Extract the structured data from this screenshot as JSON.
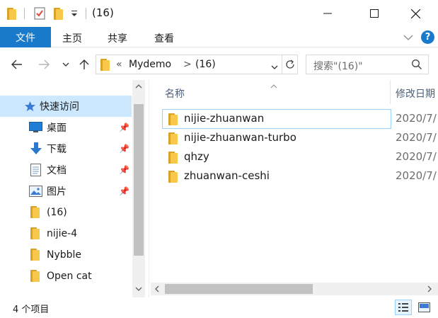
{
  "window": {
    "title": "(16)",
    "controls": {
      "minimize": "—",
      "maximize": "☐",
      "close": "✕"
    }
  },
  "ribbon": {
    "file_tab": "文件",
    "tabs": [
      "主页",
      "共享",
      "查看"
    ],
    "help": "?",
    "accent": "#1979ca"
  },
  "address": {
    "prefix": "«",
    "segments": [
      "Mydemo",
      "(16)"
    ],
    "separator": ">"
  },
  "search": {
    "placeholder": "搜索\"(16)\""
  },
  "nav_pane": {
    "items": [
      {
        "label": "快速访问",
        "icon": "star-icon",
        "pinned": false
      },
      {
        "label": "桌面",
        "icon": "desktop-icon",
        "pinned": true
      },
      {
        "label": "下载",
        "icon": "download-icon",
        "pinned": true
      },
      {
        "label": "文档",
        "icon": "document-icon",
        "pinned": true
      },
      {
        "label": "图片",
        "icon": "pictures-icon",
        "pinned": true
      },
      {
        "label": "(16)",
        "icon": "folder-icon",
        "pinned": false
      },
      {
        "label": "nijie-4",
        "icon": "folder-icon",
        "pinned": false
      },
      {
        "label": "Nybble",
        "icon": "folder-icon",
        "pinned": false
      },
      {
        "label": "Open cat",
        "icon": "folder-icon",
        "pinned": false
      }
    ]
  },
  "file_list": {
    "columns": {
      "name": "名称",
      "date_modified": "修改日期"
    },
    "sort_indicator": "^",
    "files": [
      {
        "name": "nijie-zhuanwan",
        "date": "2020/7/"
      },
      {
        "name": "nijie-zhuanwan-turbo",
        "date": "2020/7/"
      },
      {
        "name": "qhzy",
        "date": "2020/7/"
      },
      {
        "name": "zhuanwan-ceshi",
        "date": "2020/7/"
      }
    ]
  },
  "status_bar": {
    "item_count": "4 个项目"
  }
}
